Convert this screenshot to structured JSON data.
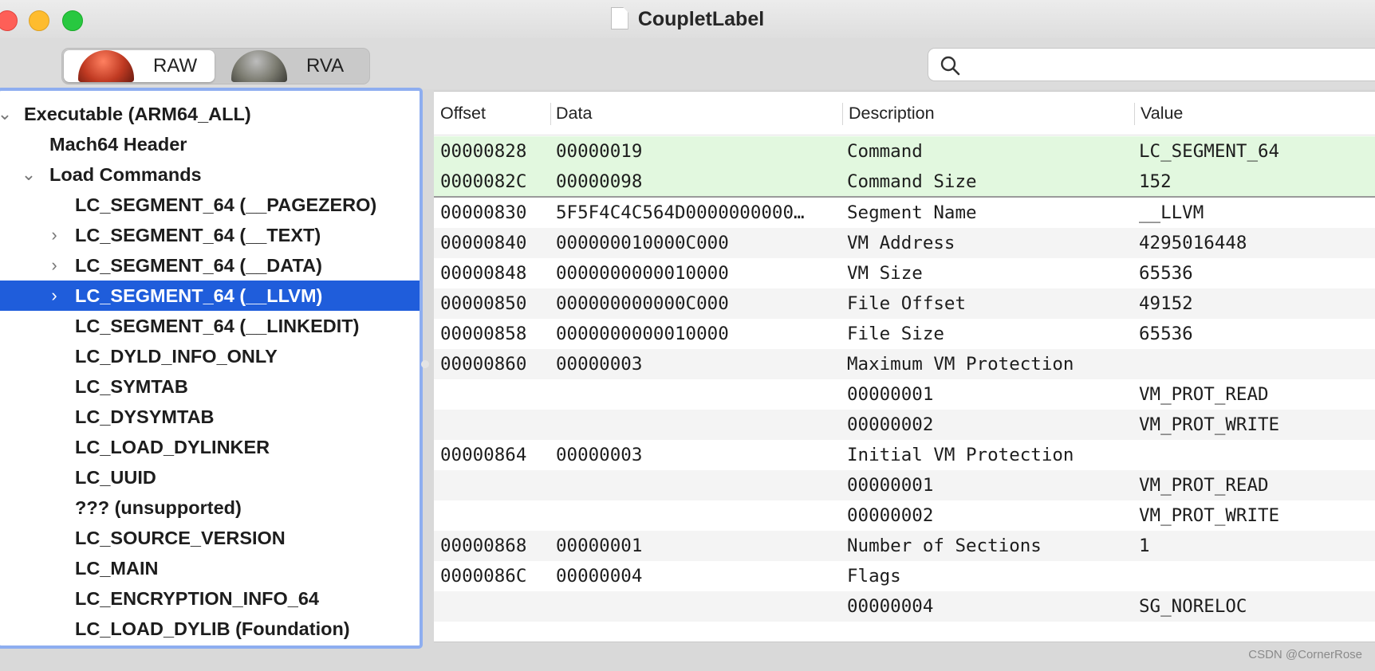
{
  "window": {
    "title": "CoupletLabel"
  },
  "toolbar": {
    "segments": [
      {
        "label": "RAW",
        "selected": true
      },
      {
        "label": "RVA",
        "selected": false
      }
    ],
    "search": {
      "value": "",
      "placeholder": ""
    }
  },
  "tree": {
    "items": [
      {
        "label": "Executable  (ARM64_ALL)",
        "level": 0,
        "disclosure": "open"
      },
      {
        "label": "Mach64 Header",
        "level": 1,
        "disclosure": "none"
      },
      {
        "label": "Load Commands",
        "level": 1,
        "disclosure": "open"
      },
      {
        "label": "LC_SEGMENT_64 (__PAGEZERO)",
        "level": 2,
        "disclosure": "none"
      },
      {
        "label": "LC_SEGMENT_64 (__TEXT)",
        "level": 2,
        "disclosure": "closed"
      },
      {
        "label": "LC_SEGMENT_64 (__DATA)",
        "level": 2,
        "disclosure": "closed"
      },
      {
        "label": "LC_SEGMENT_64 (__LLVM)",
        "level": 2,
        "disclosure": "closed",
        "selected": true
      },
      {
        "label": "LC_SEGMENT_64 (__LINKEDIT)",
        "level": 2,
        "disclosure": "none"
      },
      {
        "label": "LC_DYLD_INFO_ONLY",
        "level": 2,
        "disclosure": "none"
      },
      {
        "label": "LC_SYMTAB",
        "level": 2,
        "disclosure": "none"
      },
      {
        "label": "LC_DYSYMTAB",
        "level": 2,
        "disclosure": "none"
      },
      {
        "label": "LC_LOAD_DYLINKER",
        "level": 2,
        "disclosure": "none"
      },
      {
        "label": "LC_UUID",
        "level": 2,
        "disclosure": "none"
      },
      {
        "label": "??? (unsupported)",
        "level": 2,
        "disclosure": "none"
      },
      {
        "label": "LC_SOURCE_VERSION",
        "level": 2,
        "disclosure": "none"
      },
      {
        "label": "LC_MAIN",
        "level": 2,
        "disclosure": "none"
      },
      {
        "label": "LC_ENCRYPTION_INFO_64",
        "level": 2,
        "disclosure": "none"
      },
      {
        "label": "LC_LOAD_DYLIB (Foundation)",
        "level": 2,
        "disclosure": "none"
      }
    ]
  },
  "table": {
    "columns": [
      "Offset",
      "Data",
      "Description",
      "Value"
    ],
    "rows": [
      {
        "offset": "00000828",
        "data": "00000019",
        "description": "Command",
        "value": "LC_SEGMENT_64",
        "highlight": true
      },
      {
        "offset": "0000082C",
        "data": "00000098",
        "description": "Command Size",
        "value": "152",
        "highlight": true
      },
      {
        "offset": "00000830",
        "data": "5F5F4C4C564D0000000000…",
        "description": "Segment Name",
        "value": "__LLVM"
      },
      {
        "offset": "00000840",
        "data": "000000010000C000",
        "description": "VM Address",
        "value": "4295016448"
      },
      {
        "offset": "00000848",
        "data": "0000000000010000",
        "description": "VM Size",
        "value": "65536"
      },
      {
        "offset": "00000850",
        "data": "000000000000C000",
        "description": "File Offset",
        "value": "49152"
      },
      {
        "offset": "00000858",
        "data": "0000000000010000",
        "description": "File Size",
        "value": "65536"
      },
      {
        "offset": "00000860",
        "data": "00000003",
        "description": "Maximum VM Protection",
        "value": ""
      },
      {
        "offset": "",
        "data": "",
        "description": "00000001",
        "value": "VM_PROT_READ"
      },
      {
        "offset": "",
        "data": "",
        "description": "00000002",
        "value": "VM_PROT_WRITE"
      },
      {
        "offset": "00000864",
        "data": "00000003",
        "description": "Initial VM Protection",
        "value": ""
      },
      {
        "offset": "",
        "data": "",
        "description": "00000001",
        "value": "VM_PROT_READ"
      },
      {
        "offset": "",
        "data": "",
        "description": "00000002",
        "value": "VM_PROT_WRITE"
      },
      {
        "offset": "00000868",
        "data": "00000001",
        "description": "Number of Sections",
        "value": "1"
      },
      {
        "offset": "0000086C",
        "data": "00000004",
        "description": "Flags",
        "value": ""
      },
      {
        "offset": "",
        "data": "",
        "description": "00000004",
        "value": "SG_NORELOC"
      }
    ]
  },
  "watermark": "CSDN @CornerRose",
  "colors": {
    "selection": "#1f5ddb",
    "focus_ring": "#8eaef0",
    "highlight_row": "#e2f8df"
  }
}
